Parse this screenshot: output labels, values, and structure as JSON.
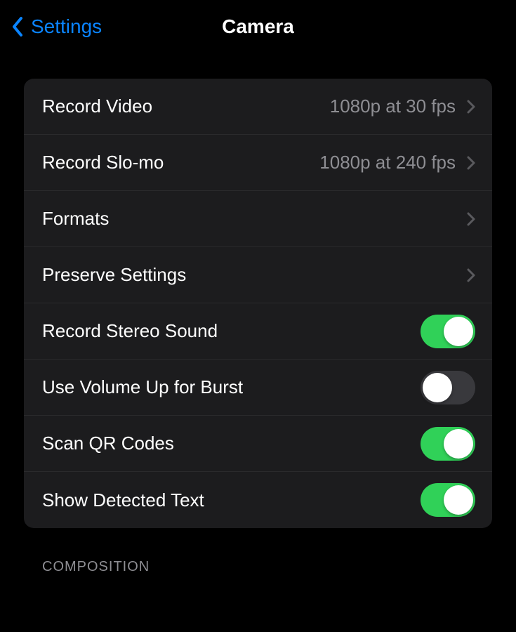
{
  "header": {
    "back_label": "Settings",
    "title": "Camera"
  },
  "rows": [
    {
      "label": "Record Video",
      "value": "1080p at 30 fps",
      "type": "nav"
    },
    {
      "label": "Record Slo-mo",
      "value": "1080p at 240 fps",
      "type": "nav"
    },
    {
      "label": "Formats",
      "value": "",
      "type": "nav"
    },
    {
      "label": "Preserve Settings",
      "value": "",
      "type": "nav"
    },
    {
      "label": "Record Stereo Sound",
      "type": "toggle",
      "on": true
    },
    {
      "label": "Use Volume Up for Burst",
      "type": "toggle",
      "on": false
    },
    {
      "label": "Scan QR Codes",
      "type": "toggle",
      "on": true
    },
    {
      "label": "Show Detected Text",
      "type": "toggle",
      "on": true
    }
  ],
  "section_header": "COMPOSITION"
}
